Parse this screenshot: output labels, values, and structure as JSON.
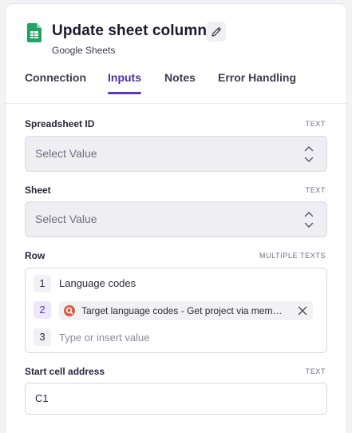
{
  "header": {
    "title": "Update sheet column",
    "subtitle": "Google Sheets",
    "app_icon": "google-sheets-icon",
    "edit_icon": "pencil-icon"
  },
  "tabs": [
    {
      "label": "Connection",
      "active": false
    },
    {
      "label": "Inputs",
      "active": true
    },
    {
      "label": "Notes",
      "active": false
    },
    {
      "label": "Error Handling",
      "active": false
    }
  ],
  "fields": {
    "spreadsheet_id": {
      "label": "Spreadsheet ID",
      "type": "TEXT",
      "placeholder": "Select Value"
    },
    "sheet": {
      "label": "Sheet",
      "type": "TEXT",
      "placeholder": "Select Value"
    },
    "row": {
      "label": "Row",
      "type": "MULTIPLE TEXTS",
      "items": [
        {
          "num": "1",
          "value": "Language codes"
        },
        {
          "num": "2",
          "chip": "Target language codes - Get project via mem…",
          "chip_icon": "variable-source-icon"
        },
        {
          "num": "3",
          "placeholder": "Type or insert value"
        }
      ]
    },
    "start_cell": {
      "label": "Start cell address",
      "type": "TEXT",
      "value": "C1"
    }
  },
  "colors": {
    "accent": "#5b36c9",
    "sheets_green": "#21a366",
    "chip_icon_red": "#e5533d"
  }
}
